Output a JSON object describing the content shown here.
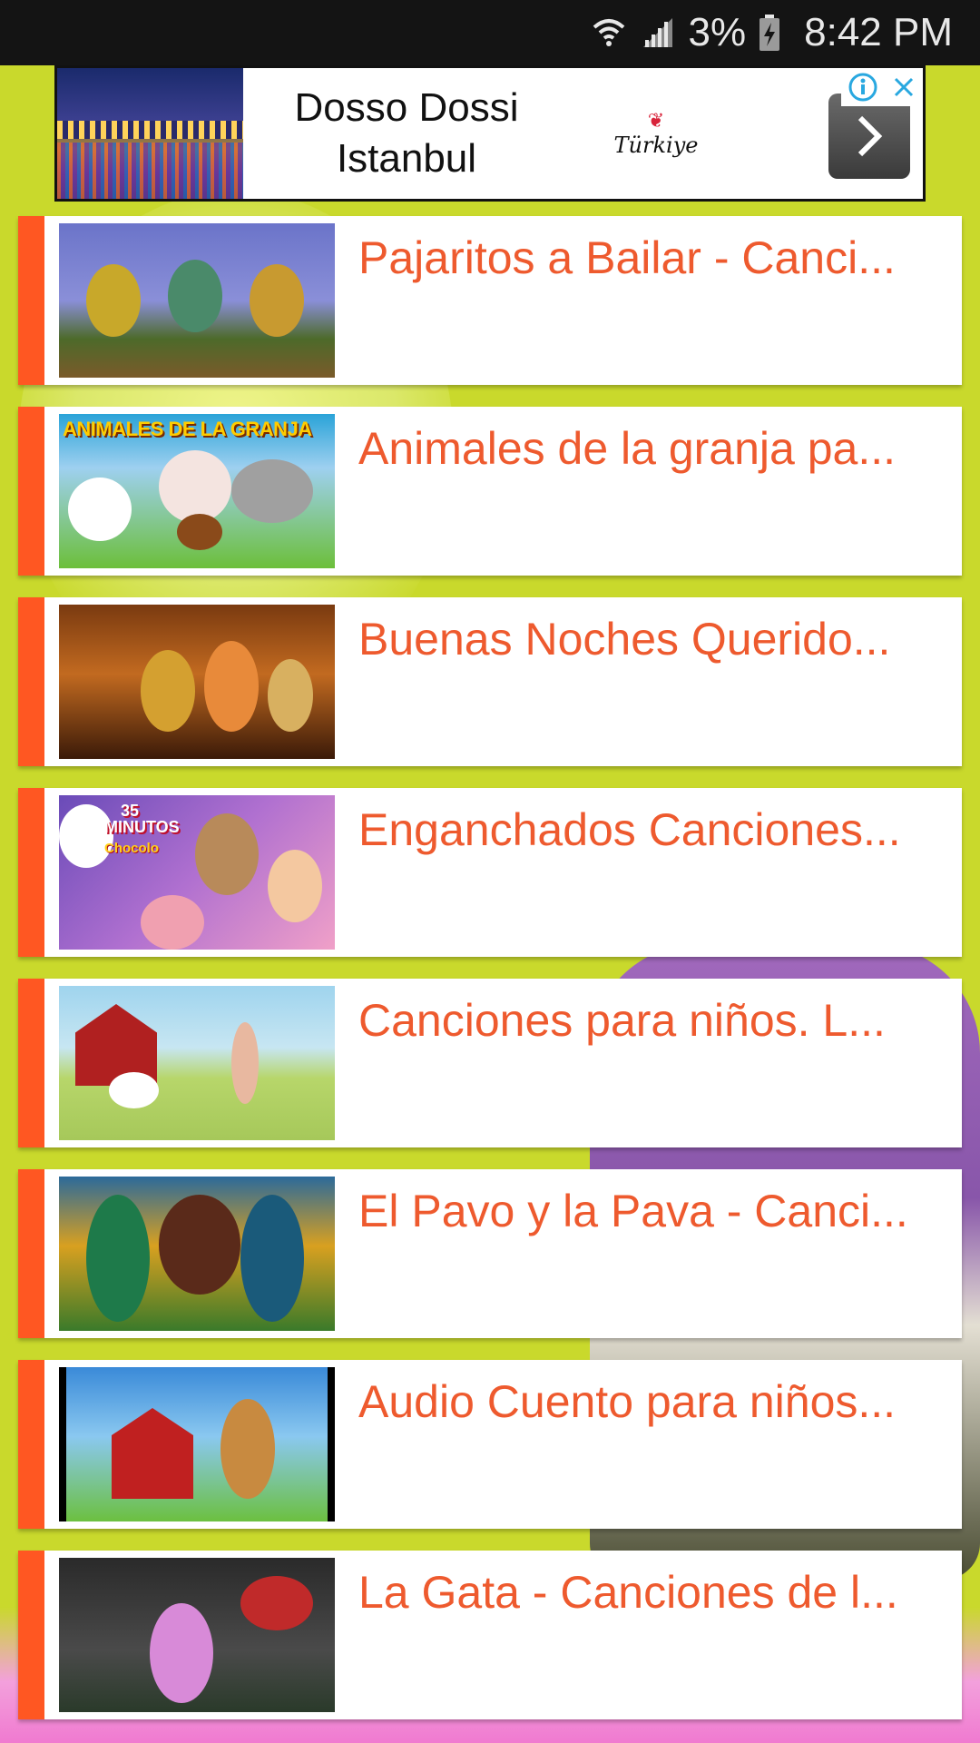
{
  "status_bar": {
    "wifi_icon": "wifi-icon",
    "signal_icon": "cell-signal-icon",
    "battery_percent": "3%",
    "battery_icon": "battery-charging-icon",
    "time": "8:42 PM"
  },
  "ad": {
    "title": "Dosso Dossi Istanbul",
    "logo_text": "Türkiye",
    "arrow_icon": "chevron-right-icon",
    "info_icon": "info-icon",
    "close_icon": "close-icon"
  },
  "videos": [
    {
      "title": "Pajaritos a Bailar - Canci...",
      "thumbnail": "birds-dancing"
    },
    {
      "title": "Animales de la granja pa...",
      "thumbnail": "farm-animals",
      "thumbnail_caption": "ANIMALES DE LA GRANJA"
    },
    {
      "title": "Buenas Noches Querido...",
      "thumbnail": "bunnies-night"
    },
    {
      "title": "Enganchados Canciones...",
      "thumbnail": "characters-collage",
      "thumbnail_badge": "35 MINUTOS",
      "thumbnail_badge_sub": "Chocolo"
    },
    {
      "title": "Canciones para niños. L...",
      "thumbnail": "barn-girl"
    },
    {
      "title": "El Pavo y la Pava - Canci...",
      "thumbnail": "turkeys-sunflowers"
    },
    {
      "title": "Audio Cuento para niños...",
      "thumbnail": "farmer-barn"
    },
    {
      "title": "La Gata - Canciones de l...",
      "thumbnail": "pink-cat-window"
    }
  ],
  "colors": {
    "accent": "#ff5722",
    "title_text": "#ee5a2e",
    "background": "#c9d92c",
    "status_bar": "#141414"
  }
}
